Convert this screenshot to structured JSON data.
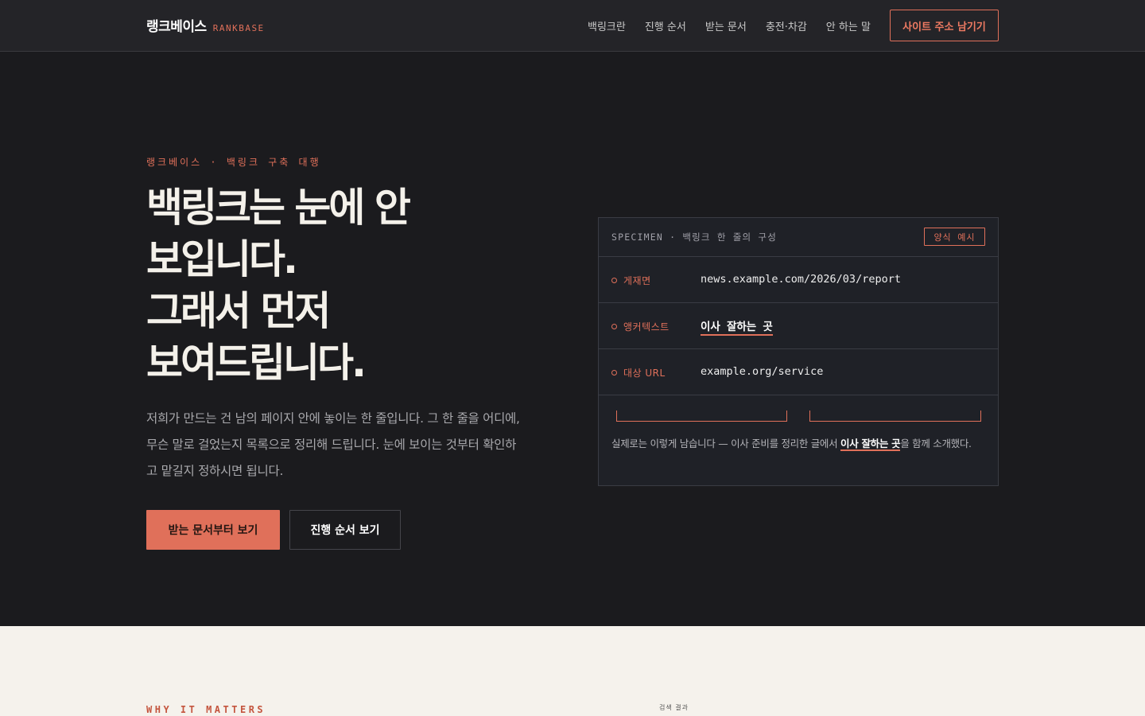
{
  "brand": {
    "name_ko": "랭크베이스",
    "name_en": "RANKBASE"
  },
  "nav": {
    "items": [
      "백링크란",
      "진행 순서",
      "받는 문서",
      "충전·차감",
      "안 하는 말"
    ],
    "cta": "사이트 주소 남기기"
  },
  "hero": {
    "eyebrow": "랭크베이스 · 백링크 구축 대행",
    "headline_lines": [
      "백링크는 눈에 안",
      "보입니다.",
      "그래서 먼저",
      "보여드립니다."
    ],
    "lede": "저희가 만드는 건 남의 페이지 안에 놓이는 한 줄입니다. 그 한 줄을 어디에, 무슨 말로 걸었는지 목록으로 정리해 드립니다. 눈에 보이는 것부터 확인하고 맡길지 정하시면 됩니다.",
    "primary_button": "받는 문서부터 보기",
    "secondary_button": "진행 순서 보기"
  },
  "specimen": {
    "title": "SPECIMEN · 백링크 한 줄의 구성",
    "badge": "양식 예시",
    "rows": [
      {
        "label": "게재면",
        "value": "news.example.com/2026/03/report"
      },
      {
        "label": "앵커텍스트",
        "value": "이사 잘하는 곳"
      },
      {
        "label": "대상 URL",
        "value": "example.org/service"
      }
    ],
    "example_before": "실제로는 이렇게 남습니다 — 이사 준비를 정리한 글에서 ",
    "example_anchor": "이사 잘하는 곳",
    "example_after": "을 함께 소개했다."
  },
  "lower": {
    "eyebrow": "WHY IT MATTERS",
    "search_label": "검색 결과"
  },
  "colors": {
    "accent": "#e0705a",
    "dark_bg": "#1b1b1e",
    "topbar_bg": "#242428",
    "card_bg": "#1f2127",
    "light_bg": "#f5f2ec"
  }
}
